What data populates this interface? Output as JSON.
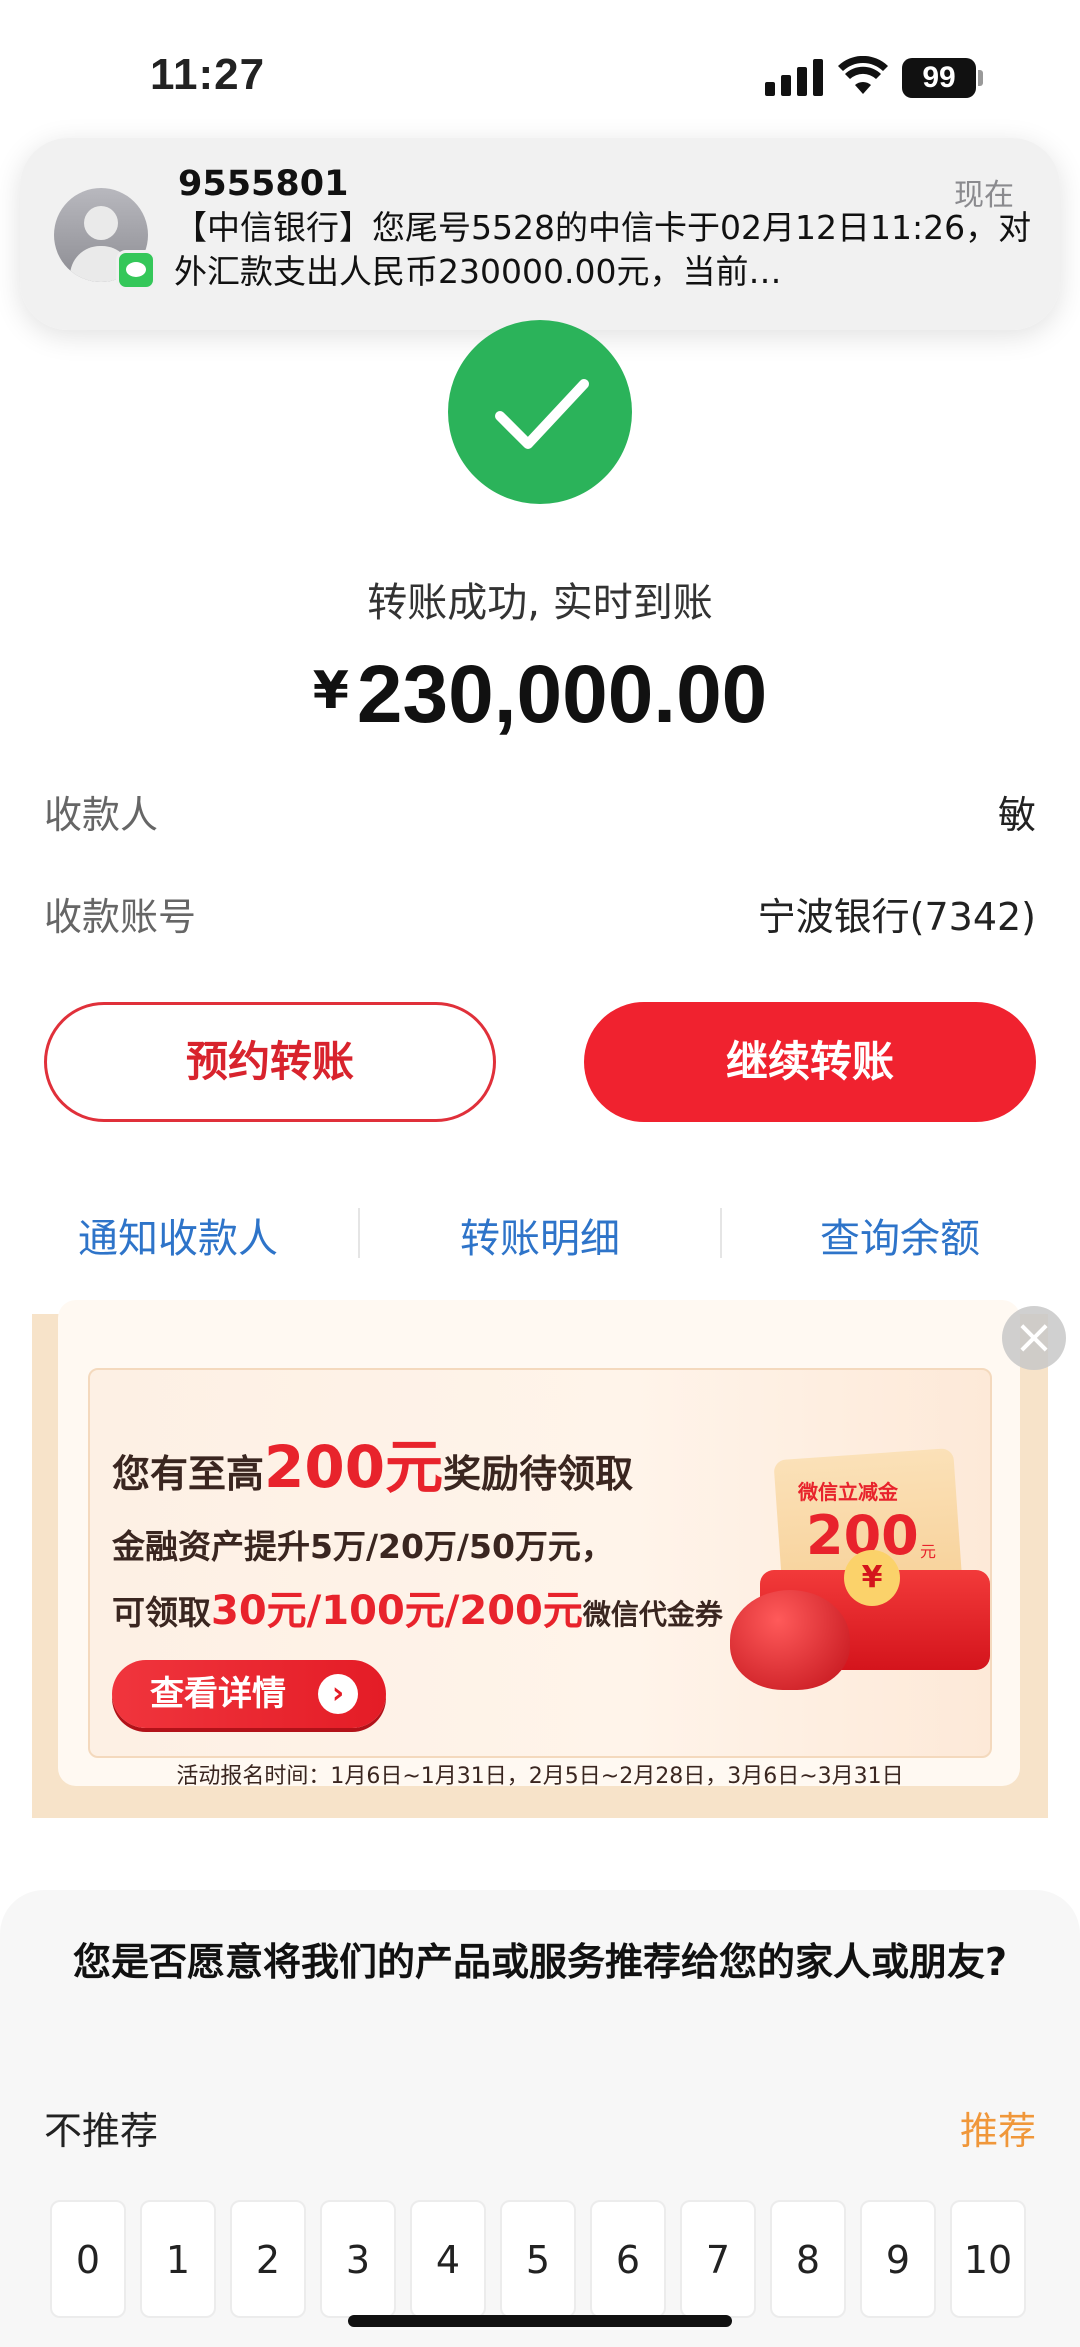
{
  "status_bar": {
    "time": "11:27",
    "battery": "99"
  },
  "notification": {
    "sender": "9555801",
    "time": "现在",
    "body": "【中信银行】您尾号5528的中信卡于02月12日11:26，对外汇款支出人民币230000.00元，当前…",
    "app_icon": "messages-icon"
  },
  "transfer": {
    "status_text": "转账成功, 实时到账",
    "currency_symbol": "¥",
    "amount": "230,000.00",
    "payee_label": "收款人",
    "payee_value": "敏",
    "account_label": "收款账号",
    "account_value": "宁波银行(7342)"
  },
  "buttons": {
    "schedule": "预约转账",
    "continue": "继续转账"
  },
  "links": {
    "notify": "通知收款人",
    "details": "转账明细",
    "balance": "查询余额"
  },
  "banner": {
    "title_prefix": "您有至高",
    "title_highlight": "200元",
    "title_suffix": "奖励待领取",
    "line1": "金融资产提升5万/20万/50万元，",
    "line2_prefix": "可领取",
    "line2_a": "30元",
    "line2_sep1": "/",
    "line2_b": "100元",
    "line2_sep2": "/",
    "line2_c": "200元",
    "line2_suffix": "微信代金券",
    "button": "查看详情",
    "footnote": "活动报名时间：1月6日~1月31日，2月5日~2月28日，3月6日~3月31日",
    "packet_label": "微信立减金",
    "packet_amount": "200",
    "packet_unit": "元",
    "packet_coin": "¥"
  },
  "survey": {
    "question": "您是否愿意将我们的产品或服务推荐给您的家人或朋友?",
    "left_label": "不推荐",
    "right_label": "推荐",
    "scores": [
      "0",
      "1",
      "2",
      "3",
      "4",
      "5",
      "6",
      "7",
      "8",
      "9",
      "10"
    ]
  },
  "colors": {
    "brand_red": "#f0222f",
    "success_green": "#2bb35a",
    "link_blue": "#2e74c9",
    "recommend_orange": "#f0973a"
  }
}
